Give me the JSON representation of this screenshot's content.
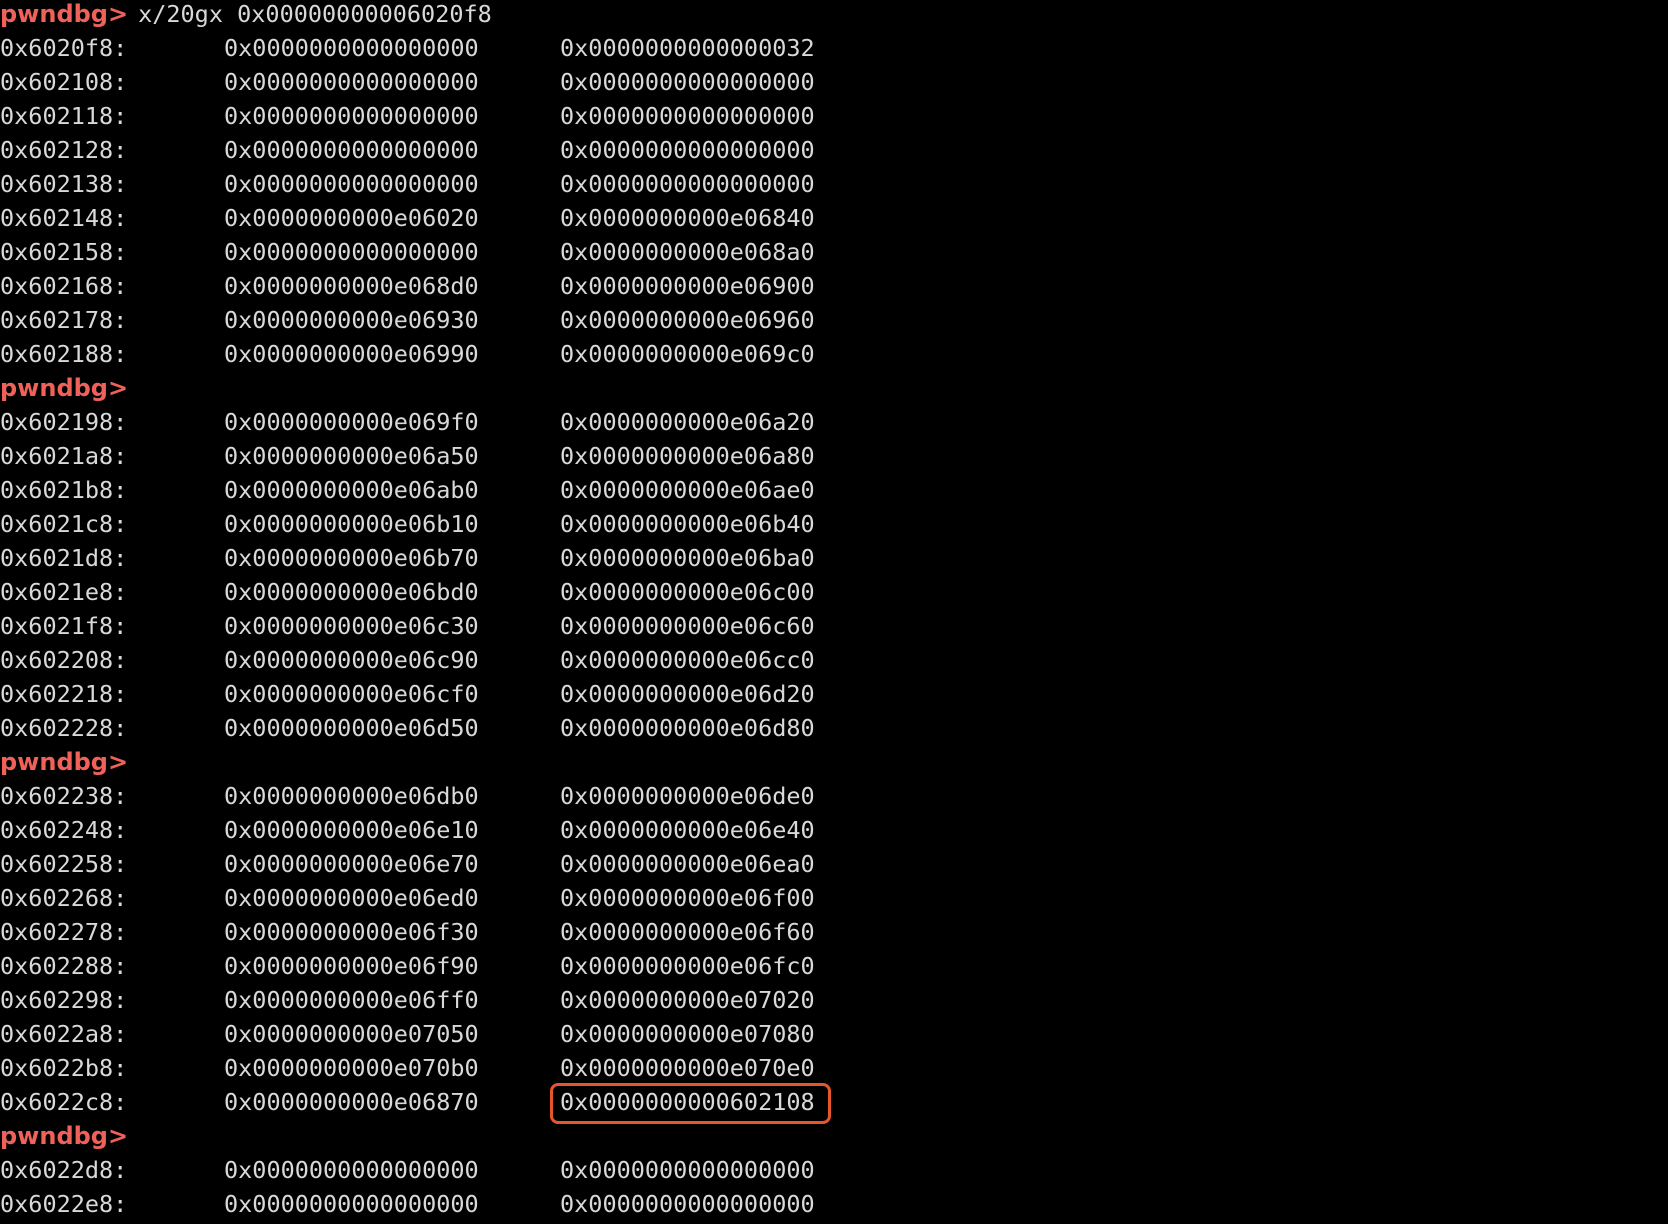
{
  "colors": {
    "background": "#000000",
    "text": "#d9d9d9",
    "prompt": "#f0615a",
    "highlight_border": "#e9552b"
  },
  "terminal": {
    "prompt": "pwndbg>",
    "command": "x/20gx 0x00000000006020f8",
    "blocks": [
      {
        "rows": [
          {
            "addr": "0x6020f8:",
            "v1": "0x0000000000000000",
            "v2": "0x0000000000000032"
          },
          {
            "addr": "0x602108:",
            "v1": "0x0000000000000000",
            "v2": "0x0000000000000000"
          },
          {
            "addr": "0x602118:",
            "v1": "0x0000000000000000",
            "v2": "0x0000000000000000"
          },
          {
            "addr": "0x602128:",
            "v1": "0x0000000000000000",
            "v2": "0x0000000000000000"
          },
          {
            "addr": "0x602138:",
            "v1": "0x0000000000000000",
            "v2": "0x0000000000000000"
          },
          {
            "addr": "0x602148:",
            "v1": "0x0000000000e06020",
            "v2": "0x0000000000e06840"
          },
          {
            "addr": "0x602158:",
            "v1": "0x0000000000000000",
            "v2": "0x0000000000e068a0"
          },
          {
            "addr": "0x602168:",
            "v1": "0x0000000000e068d0",
            "v2": "0x0000000000e06900"
          },
          {
            "addr": "0x602178:",
            "v1": "0x0000000000e06930",
            "v2": "0x0000000000e06960"
          },
          {
            "addr": "0x602188:",
            "v1": "0x0000000000e06990",
            "v2": "0x0000000000e069c0"
          }
        ]
      },
      {
        "rows": [
          {
            "addr": "0x602198:",
            "v1": "0x0000000000e069f0",
            "v2": "0x0000000000e06a20"
          },
          {
            "addr": "0x6021a8:",
            "v1": "0x0000000000e06a50",
            "v2": "0x0000000000e06a80"
          },
          {
            "addr": "0x6021b8:",
            "v1": "0x0000000000e06ab0",
            "v2": "0x0000000000e06ae0"
          },
          {
            "addr": "0x6021c8:",
            "v1": "0x0000000000e06b10",
            "v2": "0x0000000000e06b40"
          },
          {
            "addr": "0x6021d8:",
            "v1": "0x0000000000e06b70",
            "v2": "0x0000000000e06ba0"
          },
          {
            "addr": "0x6021e8:",
            "v1": "0x0000000000e06bd0",
            "v2": "0x0000000000e06c00"
          },
          {
            "addr": "0x6021f8:",
            "v1": "0x0000000000e06c30",
            "v2": "0x0000000000e06c60"
          },
          {
            "addr": "0x602208:",
            "v1": "0x0000000000e06c90",
            "v2": "0x0000000000e06cc0"
          },
          {
            "addr": "0x602218:",
            "v1": "0x0000000000e06cf0",
            "v2": "0x0000000000e06d20"
          },
          {
            "addr": "0x602228:",
            "v1": "0x0000000000e06d50",
            "v2": "0x0000000000e06d80"
          }
        ]
      },
      {
        "rows": [
          {
            "addr": "0x602238:",
            "v1": "0x0000000000e06db0",
            "v2": "0x0000000000e06de0"
          },
          {
            "addr": "0x602248:",
            "v1": "0x0000000000e06e10",
            "v2": "0x0000000000e06e40"
          },
          {
            "addr": "0x602258:",
            "v1": "0x0000000000e06e70",
            "v2": "0x0000000000e06ea0"
          },
          {
            "addr": "0x602268:",
            "v1": "0x0000000000e06ed0",
            "v2": "0x0000000000e06f00"
          },
          {
            "addr": "0x602278:",
            "v1": "0x0000000000e06f30",
            "v2": "0x0000000000e06f60"
          },
          {
            "addr": "0x602288:",
            "v1": "0x0000000000e06f90",
            "v2": "0x0000000000e06fc0"
          },
          {
            "addr": "0x602298:",
            "v1": "0x0000000000e06ff0",
            "v2": "0x0000000000e07020"
          },
          {
            "addr": "0x6022a8:",
            "v1": "0x0000000000e07050",
            "v2": "0x0000000000e07080"
          },
          {
            "addr": "0x6022b8:",
            "v1": "0x0000000000e070b0",
            "v2": "0x0000000000e070e0"
          },
          {
            "addr": "0x6022c8:",
            "v1": "0x0000000000e06870",
            "v2": "0x0000000000602108",
            "highlight_v2": true
          }
        ]
      },
      {
        "rows": [
          {
            "addr": "0x6022d8:",
            "v1": "0x0000000000000000",
            "v2": "0x0000000000000000"
          },
          {
            "addr": "0x6022e8:",
            "v1": "0x0000000000000000",
            "v2": "0x0000000000000000"
          }
        ]
      }
    ]
  }
}
